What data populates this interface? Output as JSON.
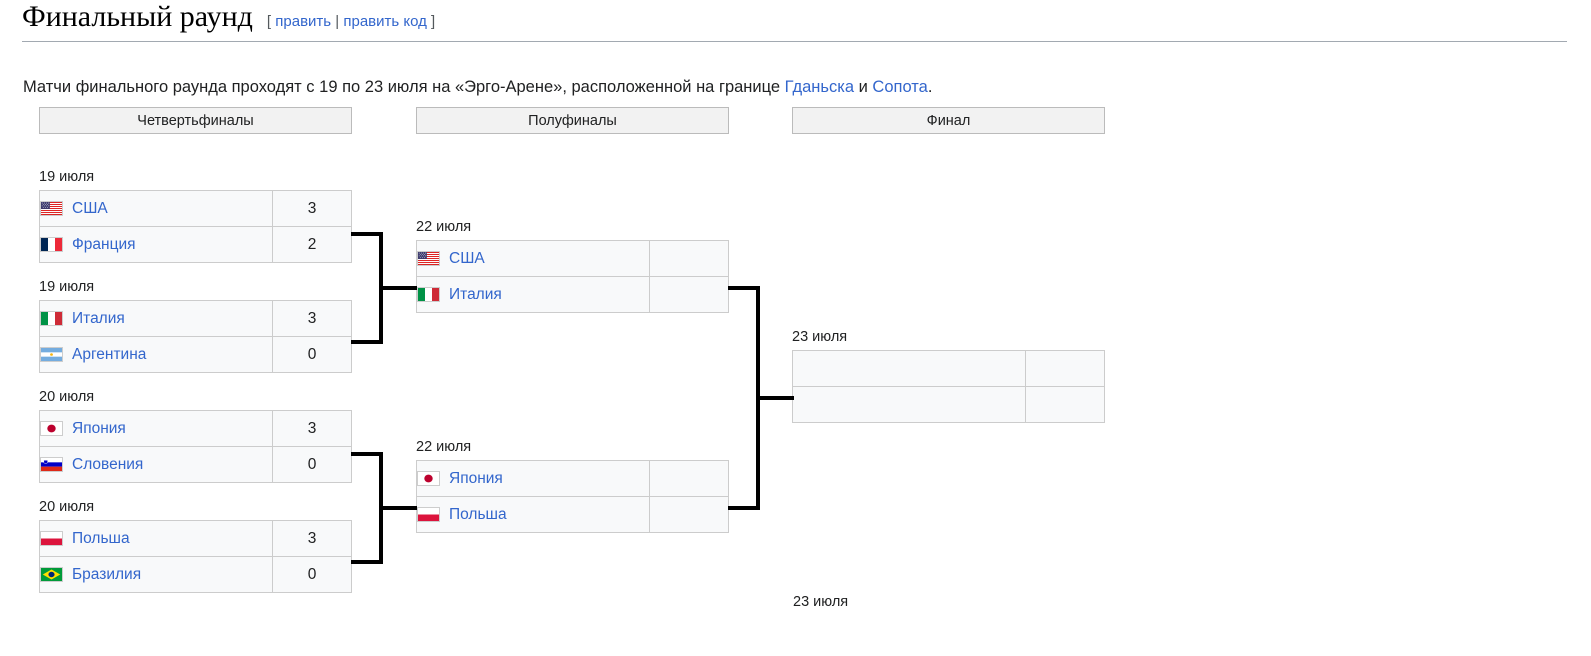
{
  "heading": {
    "title": "Финальный раунд",
    "edit_open": "[",
    "edit_link_1": "править",
    "edit_sep": "|",
    "edit_link_2": "править код",
    "edit_close": "]"
  },
  "intro": {
    "part1": "Матчи финального раунда проходят с 19 по 23 июля на «Эрго-Арене», расположенной на границе ",
    "link1": "Гданьска",
    "part2": " и ",
    "link2": "Сопота",
    "part3": "."
  },
  "rounds": [
    {
      "label": "Четвертьфиналы"
    },
    {
      "label": "Полуфиналы"
    },
    {
      "label": "Финал"
    }
  ],
  "quarterfinals": [
    {
      "date": "19 июля",
      "teams": [
        {
          "name": "США",
          "flag": "flag-usa",
          "score": "3"
        },
        {
          "name": "Франция",
          "flag": "flag-france",
          "score": "2"
        }
      ]
    },
    {
      "date": "19 июля",
      "teams": [
        {
          "name": "Италия",
          "flag": "flag-italy",
          "score": "3"
        },
        {
          "name": "Аргентина",
          "flag": "flag-argentina",
          "score": "0"
        }
      ]
    },
    {
      "date": "20 июля",
      "teams": [
        {
          "name": "Япония",
          "flag": "flag-japan",
          "score": "3"
        },
        {
          "name": "Словения",
          "flag": "flag-slovenia",
          "score": "0"
        }
      ]
    },
    {
      "date": "20 июля",
      "teams": [
        {
          "name": "Польша",
          "flag": "flag-poland",
          "score": "3"
        },
        {
          "name": "Бразилия",
          "flag": "flag-brazil",
          "score": "0"
        }
      ]
    }
  ],
  "semifinals": [
    {
      "date": "22 июля",
      "teams": [
        {
          "name": "США",
          "flag": "flag-usa",
          "score": ""
        },
        {
          "name": "Италия",
          "flag": "flag-italy",
          "score": ""
        }
      ]
    },
    {
      "date": "22 июля",
      "teams": [
        {
          "name": "Япония",
          "flag": "flag-japan",
          "score": ""
        },
        {
          "name": "Польша",
          "flag": "flag-poland",
          "score": ""
        }
      ]
    }
  ],
  "final": {
    "date": "23 июля",
    "teams": [
      {
        "name": "",
        "flag": "",
        "score": ""
      },
      {
        "name": "",
        "flag": "",
        "score": ""
      }
    ]
  },
  "third_place": {
    "date": "23 июля"
  },
  "colors": {
    "link": "#3366cc",
    "text": "#202122",
    "table_bg": "#f8f9fa",
    "table_border": "#cccccc",
    "round_header_bg": "#f2f2f2",
    "round_header_border": "#bbbbbb",
    "connector": "#000000",
    "rule": "#a2a9b1"
  }
}
